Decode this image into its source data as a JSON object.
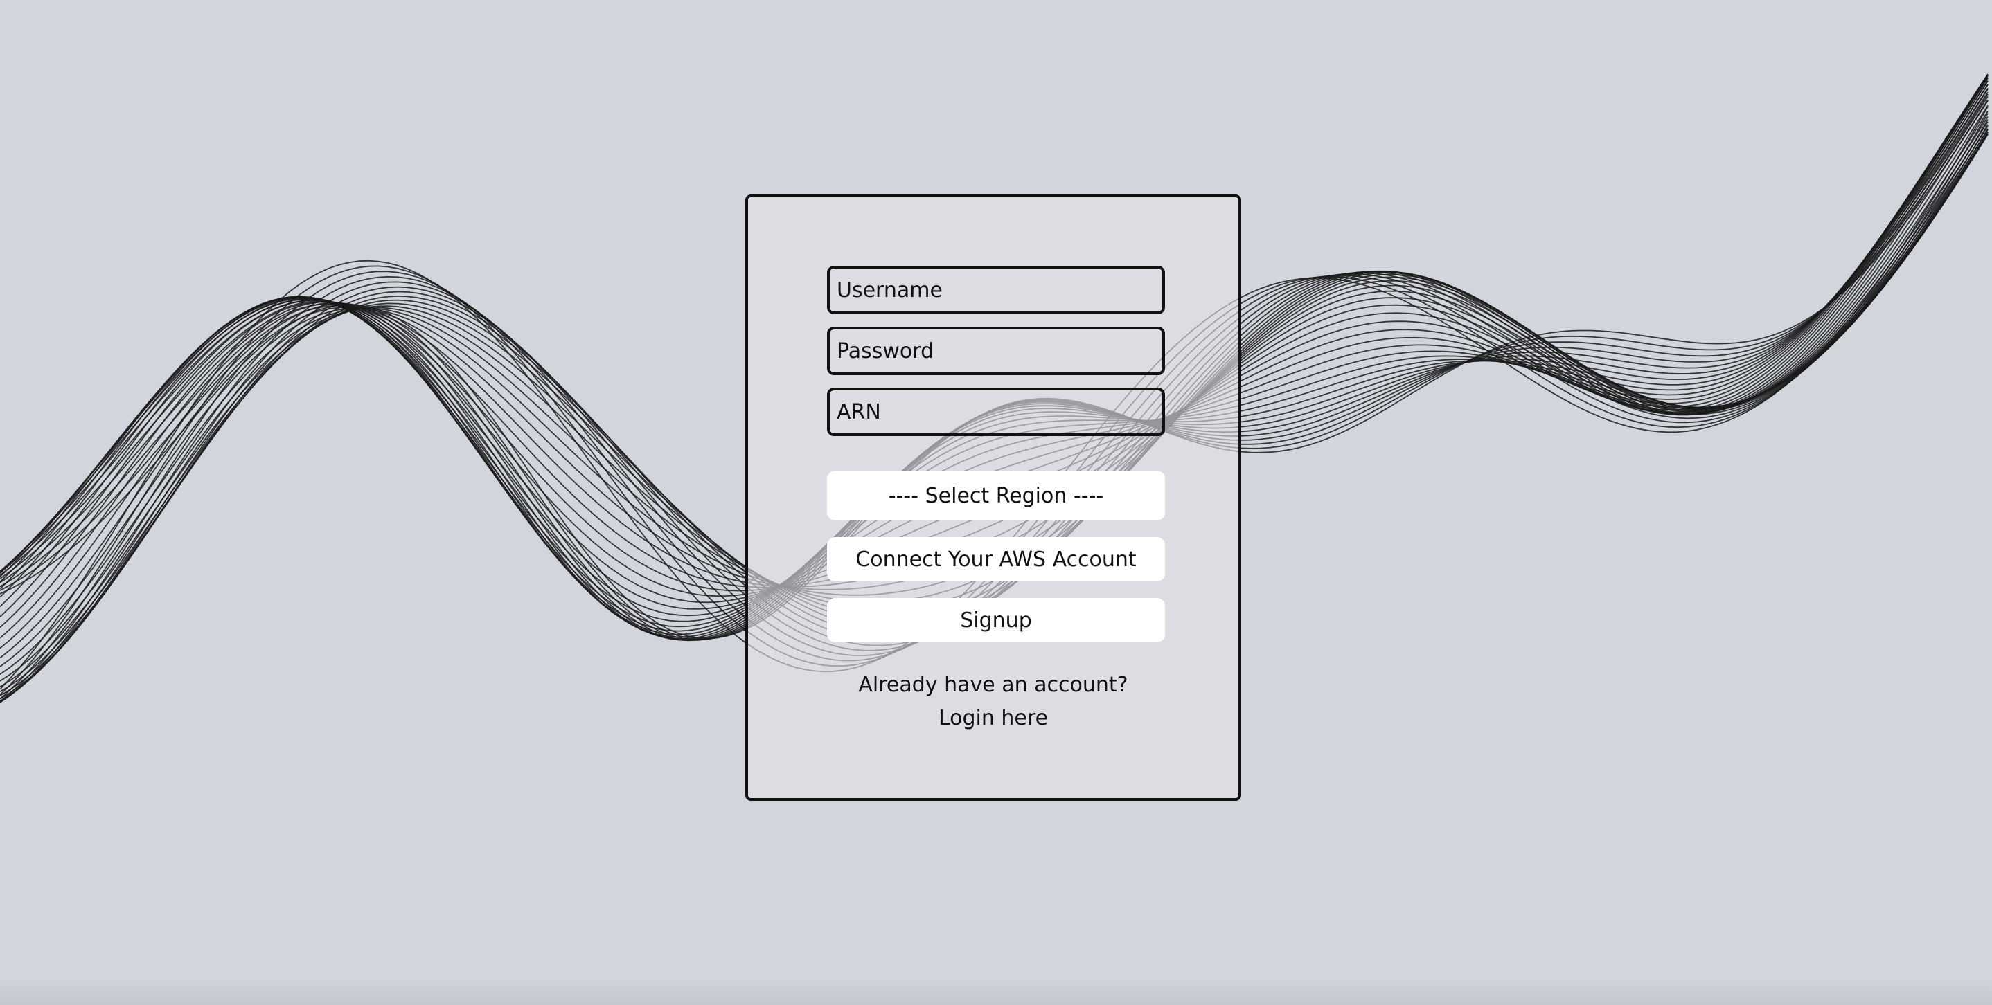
{
  "form": {
    "username_placeholder": "Username",
    "password_placeholder": "Password",
    "arn_placeholder": "ARN",
    "region_label": "---- Select Region ----",
    "connect_label": "Connect Your AWS Account",
    "signup_label": "Signup",
    "have_account_text": "Already have an account?",
    "login_link_text": "Login here"
  },
  "theme": {
    "background": "#d2d5dc",
    "wave_color": "#1a1a1a",
    "button_bg": "#ffffff",
    "text_color": "#111111"
  }
}
